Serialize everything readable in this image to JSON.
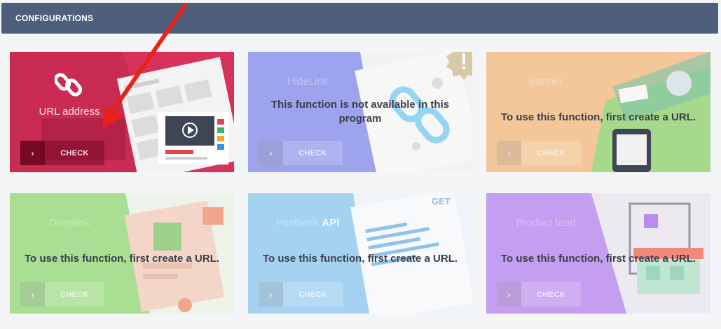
{
  "header": {
    "title": "CONFIGURATIONS"
  },
  "cards": [
    {
      "title": "URL address",
      "message": "",
      "button": "CHECK",
      "icon": "link-icon",
      "status": "available"
    },
    {
      "title": "HideLink",
      "message": "This function is not available in this program",
      "button": "CHECK",
      "icon": "warning-badge-icon",
      "status": "not-available"
    },
    {
      "title": "Banner",
      "message": "To use this function, first create a URL.",
      "button": "CHECK",
      "status": "locked"
    },
    {
      "title": "Deeplink",
      "message": "To use this function, first create a URL.",
      "button": "CHECK",
      "status": "locked"
    },
    {
      "title": "Postback",
      "title_bold": "API",
      "message": "To use this function, first create a URL.",
      "button": "CHECK",
      "status": "locked"
    },
    {
      "title": "Product feed",
      "message": "To use this function, first create a URL.",
      "button": "CHECK",
      "status": "locked"
    }
  ],
  "colors": {
    "header": "#4d5f7a",
    "url_card": "#d6325a",
    "hidelink_card": "#9da3ec",
    "banner_card": "#f3c79a",
    "deeplink_card": "#a9df93",
    "postback_card": "#a6d2f2",
    "product_feed_card": "#c49ef0",
    "arrow": "#e8221b"
  }
}
